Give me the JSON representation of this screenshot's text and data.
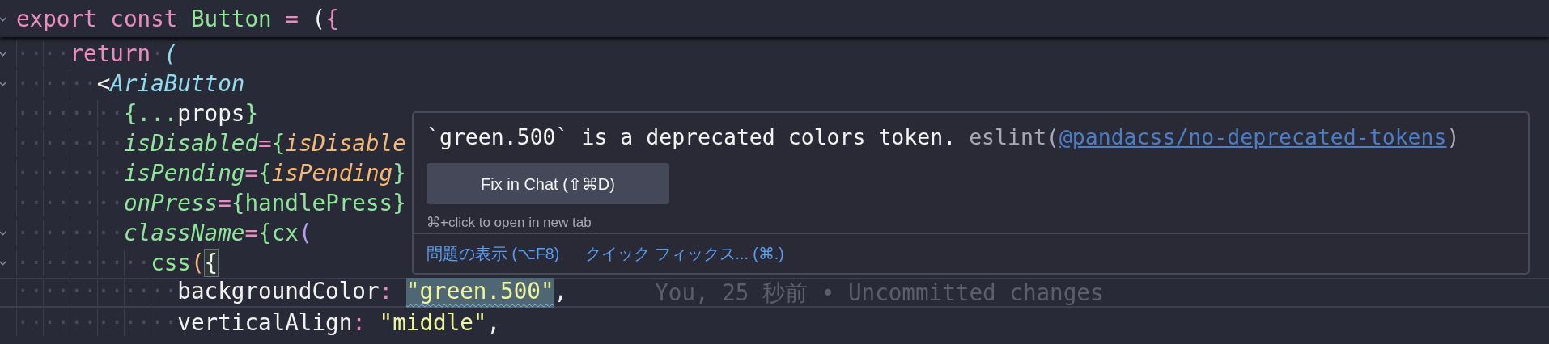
{
  "sticky_line": {
    "fold": true,
    "tokens": [
      {
        "text": "export const ",
        "kind": "keyword"
      },
      {
        "text": "Button",
        "kind": "name"
      },
      {
        "text": " = ",
        "kind": "keyword"
      },
      {
        "text": "(",
        "kind": "plain"
      },
      {
        "text": "{",
        "kind": "keyword"
      }
    ]
  },
  "lines": [
    {
      "fold": true,
      "current": false,
      "tokens": [
        {
          "text": "····",
          "kind": "whitespace"
        },
        {
          "text": "return",
          "kind": "keyword"
        },
        {
          "text": "·",
          "kind": "whitespace"
        },
        {
          "text": "(",
          "kind": "tag"
        }
      ]
    },
    {
      "fold": true,
      "current": false,
      "tokens": [
        {
          "text": "······",
          "kind": "whitespace"
        },
        {
          "text": "<",
          "kind": "plain"
        },
        {
          "text": "AriaButton",
          "kind": "tag"
        }
      ]
    },
    {
      "fold": false,
      "current": false,
      "tokens": [
        {
          "text": "········",
          "kind": "whitespace"
        },
        {
          "text": "{...",
          "kind": "brace"
        },
        {
          "text": "props",
          "kind": "plain"
        },
        {
          "text": "}",
          "kind": "brace"
        }
      ]
    },
    {
      "fold": false,
      "current": false,
      "tokens": [
        {
          "text": "········",
          "kind": "whitespace"
        },
        {
          "text": "isDisabled",
          "kind": "attr"
        },
        {
          "text": "=",
          "kind": "keyword"
        },
        {
          "text": "{",
          "kind": "brace"
        },
        {
          "text": "isDisable",
          "kind": "param"
        }
      ]
    },
    {
      "fold": false,
      "current": false,
      "tokens": [
        {
          "text": "········",
          "kind": "whitespace"
        },
        {
          "text": "isPending",
          "kind": "attr"
        },
        {
          "text": "=",
          "kind": "keyword"
        },
        {
          "text": "{",
          "kind": "brace"
        },
        {
          "text": "isPending",
          "kind": "param"
        },
        {
          "text": "}",
          "kind": "brace"
        }
      ]
    },
    {
      "fold": false,
      "current": false,
      "tokens": [
        {
          "text": "········",
          "kind": "whitespace"
        },
        {
          "text": "onPress",
          "kind": "attr"
        },
        {
          "text": "=",
          "kind": "keyword"
        },
        {
          "text": "{",
          "kind": "brace"
        },
        {
          "text": "handlePress",
          "kind": "name"
        },
        {
          "text": "}",
          "kind": "brace"
        }
      ]
    },
    {
      "fold": true,
      "current": false,
      "tokens": [
        {
          "text": "········",
          "kind": "whitespace"
        },
        {
          "text": "className",
          "kind": "attr"
        },
        {
          "text": "=",
          "kind": "keyword"
        },
        {
          "text": "{",
          "kind": "brace"
        },
        {
          "text": "cx",
          "kind": "name"
        },
        {
          "text": "(",
          "kind": "bracket"
        }
      ]
    },
    {
      "fold": true,
      "current": false,
      "tokens": [
        {
          "text": "··········",
          "kind": "whitespace"
        },
        {
          "text": "css",
          "kind": "name"
        },
        {
          "text": "(",
          "kind": "paren"
        },
        {
          "text": "{",
          "kind": "match"
        }
      ]
    },
    {
      "fold": false,
      "current": true,
      "tokens": [
        {
          "text": "············",
          "kind": "whitespace"
        },
        {
          "text": "backgroundColor",
          "kind": "plain"
        },
        {
          "text": ": ",
          "kind": "keyword"
        },
        {
          "text": "\"green.500\"",
          "kind": "problem"
        },
        {
          "text": ",",
          "kind": "plain"
        },
        {
          "text": "You, 25 秒前 • Uncommitted changes",
          "kind": "ghost"
        }
      ]
    },
    {
      "fold": false,
      "current": false,
      "tokens": [
        {
          "text": "············",
          "kind": "whitespace"
        },
        {
          "text": "verticalAlign",
          "kind": "plain"
        },
        {
          "text": ": ",
          "kind": "keyword"
        },
        {
          "text": "\"middle\"",
          "kind": "string"
        },
        {
          "text": ",",
          "kind": "plain"
        }
      ]
    }
  ],
  "hover": {
    "message": "`green.500` is a deprecated colors token.",
    "source": "eslint(",
    "rule_link": "@pandacss/no-deprecated-tokens",
    "source_end": ")",
    "button": "Fix in Chat (⇧⌘D)",
    "hint": "⌘+click to open in new tab",
    "actions": [
      "問題の表示 (⌥F8)",
      "クイック フィックス... (⌘.)"
    ]
  }
}
